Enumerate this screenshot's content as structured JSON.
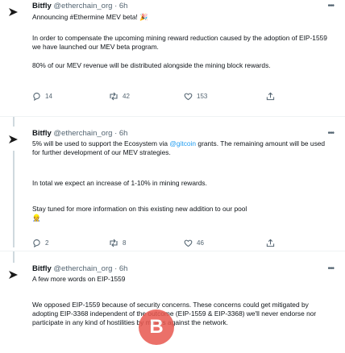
{
  "tweets": [
    {
      "name": "Bitfly",
      "handle": "@etherchain_org",
      "sep": "·",
      "time": "6h",
      "headline": "Announcing #Ethermine MEV beta! 🎉",
      "para1": "In order to compensate the upcoming mining reward reduction caused by the adoption of EIP-1559 we have launched our MEV beta program.",
      "para2": "80% of our MEV revenue will be distributed alongside the mining block rewards.",
      "replies": "14",
      "retweets": "42",
      "likes": "153"
    },
    {
      "name": "Bitfly",
      "handle": "@etherchain_org",
      "sep": "·",
      "time": "6h",
      "para1_a": "5% will be used to support the Ecosystem via ",
      "para1_link": "@gitcoin",
      "para1_b": " grants. The remaining amount will be used for further development of our MEV strategies.",
      "para2": "In total we expect an increase of 1-10% in mining rewards.",
      "para3": "Stay tuned for more information on this existing new addition to our pool",
      "para3_emoji": "👷",
      "replies": "2",
      "retweets": "8",
      "likes": "46"
    },
    {
      "name": "Bitfly",
      "handle": "@etherchain_org",
      "sep": "·",
      "time": "6h",
      "headline": "A few more words on EIP-1559",
      "para1": "We opposed EIP-1559 because of security concerns. These concerns could get mitigated by adopting EIP-3368 independent of the outcome (EIP-1559 & EIP-3368) we'll never endorse nor participate in any kind of hostilities by miners against the network."
    }
  ],
  "watermark_glyph": "B"
}
